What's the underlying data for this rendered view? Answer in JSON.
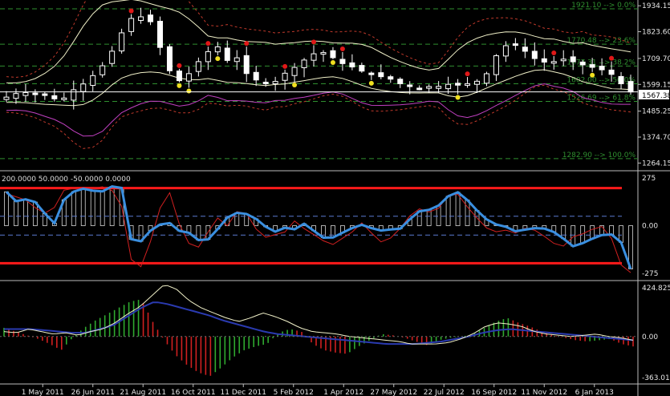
{
  "colors": {
    "background": "#000000",
    "candle_up": "#ffffff",
    "candle_down": "#ffffff",
    "fib_line": "#2f8f2f",
    "price_line": "#ffffff",
    "bb_outer": "#c0392b",
    "envelope_inner": "#f0f0c8",
    "envelope_lower": "#c040c0",
    "cci_main": "#3a8fe0",
    "cci_signal": "#d02020",
    "cci_levels": "#ff1a1a",
    "hist_up": "#2faa2f",
    "hist_down": "#d02020",
    "osc_line": "#f0f0c8",
    "osc_signal": "#2a3ab0"
  },
  "price_axis": {
    "labels": [
      "1934.15",
      "1823.60",
      "1709.70",
      "1599.15",
      "1485.25",
      "1374.70",
      "1264.15"
    ],
    "current": "1567.38"
  },
  "fib_levels": [
    {
      "label": "1921.10 --> 0.0%",
      "value": 1921.1
    },
    {
      "label": "1770.48 --> 23.6%",
      "value": 1770.48
    },
    {
      "label": "1677.31 --> 38.2%",
      "value": 1677.31
    },
    {
      "label": "1602.00 --> 50.0%",
      "value": 1602.0
    },
    {
      "label": "1526.69 --> 61.8%",
      "value": 1526.69
    },
    {
      "label": "1282.90 --> 100.0%",
      "value": 1282.9
    }
  ],
  "cci_panel": {
    "header": "200.0000 50.0000 -50.0000 0.0000",
    "axis": [
      "275",
      "0.00",
      "-275"
    ],
    "levels": [
      200,
      50,
      -50,
      -200
    ]
  },
  "osc_panel": {
    "axis": [
      "424.825",
      "0.00",
      "-363.019"
    ]
  },
  "time_axis": [
    "1 May 2011",
    "26 Jun 2011",
    "21 Aug 2011",
    "16 Oct 2011",
    "11 Dec 2011",
    "5 Feb 2012",
    "1 Apr 2012",
    "27 May 2012",
    "22 Jul 2012",
    "16 Sep 2012",
    "11 Nov 2012",
    "6 Jan 2013"
  ],
  "chart_data": [
    {
      "type": "candlestick",
      "title": "",
      "ylim": [
        1245,
        1945
      ],
      "x": [
        "1 May 2011",
        "26 Jun 2011",
        "21 Aug 2011",
        "16 Oct 2011",
        "11 Dec 2011",
        "5 Feb 2012",
        "1 Apr 2012",
        "27 May 2012",
        "22 Jul 2012",
        "16 Sep 2012",
        "11 Nov 2012",
        "6 Jan 2013"
      ],
      "close_series": [
        1545,
        1560,
        1565,
        1555,
        1560,
        1540,
        1530,
        1570,
        1590,
        1620,
        1660,
        1700,
        1780,
        1850,
        1900,
        1880,
        1860,
        1720,
        1640,
        1610,
        1650,
        1700,
        1740,
        1760,
        1700,
        1720,
        1650,
        1620,
        1610,
        1600,
        1640,
        1660,
        1690,
        1720,
        1740,
        1730,
        1700,
        1680,
        1670,
        1650,
        1640,
        1630,
        1620,
        1600,
        1590,
        1580,
        1590,
        1590,
        1600,
        1595,
        1600,
        1610,
        1620,
        1700,
        1760,
        1770,
        1760,
        1720,
        1700,
        1690,
        1700,
        1710,
        1690,
        1680,
        1670,
        1660,
        1640,
        1600,
        1567
      ],
      "fibonacci": [
        {
          "level": "0.0%",
          "value": 1921.1
        },
        {
          "level": "23.6%",
          "value": 1770.48
        },
        {
          "level": "38.2%",
          "value": 1677.31
        },
        {
          "level": "50.0%",
          "value": 1602.0
        },
        {
          "level": "61.8%",
          "value": 1526.69
        },
        {
          "level": "100.0%",
          "value": 1282.9
        }
      ],
      "current_price": 1567.38
    },
    {
      "type": "line",
      "ylim": [
        -275,
        275
      ],
      "levels": [
        200,
        50,
        -50,
        -200
      ],
      "series": [
        {
          "values": [
            180,
            120,
            150,
            100,
            -10,
            140,
            190,
            200,
            170,
            210,
            200,
            -140,
            -50,
            0,
            20,
            -30,
            -40,
            -100,
            -40,
            40,
            70,
            60,
            20,
            -40,
            -10,
            -20,
            20,
            -60,
            -70,
            -40,
            -10,
            10,
            -30,
            -20,
            -20,
            40,
            90,
            80,
            150,
            180,
            130,
            60,
            10,
            0,
            -30,
            -20,
            -10,
            -20,
            -60,
            -110,
            -90,
            -60,
            -40,
            -60,
            -230
          ]
        },
        {
          "values": [
            170,
            150,
            130,
            60,
            80,
            190,
            200,
            190,
            210,
            200,
            100,
            -250,
            -200,
            50,
            200,
            0,
            -120,
            -110,
            60,
            -10,
            80,
            60,
            -70,
            -50,
            -40,
            30,
            -30,
            -60,
            -110,
            -70,
            -30,
            30,
            -90,
            -80,
            -20,
            60,
            100,
            50,
            160,
            170,
            90,
            20,
            -40,
            -20,
            -40,
            -10,
            -30,
            -80,
            -120,
            -60,
            -40,
            -10,
            0,
            -200,
            -250
          ]
        }
      ]
    },
    {
      "type": "bar",
      "ylim": [
        -363.019,
        424.825
      ],
      "values": [
        70,
        40,
        10,
        -20,
        -60,
        -110,
        -10,
        70,
        130,
        180,
        230,
        280,
        300,
        120,
        -30,
        -150,
        -230,
        -290,
        -320,
        -250,
        -170,
        -110,
        -80,
        -60,
        30,
        60,
        40,
        -60,
        -110,
        -130,
        -140,
        -80,
        -30,
        20,
        10,
        -10,
        -40,
        -70,
        -30,
        -10,
        0,
        20,
        70,
        120,
        150,
        110,
        80,
        40,
        10,
        -10,
        -30,
        -40,
        -30,
        -20,
        -60,
        -80
      ],
      "series": [
        {
          "values": [
            40,
            30,
            60,
            40,
            20,
            30,
            10,
            40,
            60,
            110,
            180,
            240,
            330,
            420,
            380,
            290,
            230,
            190,
            150,
            120,
            150,
            190,
            160,
            120,
            70,
            40,
            30,
            20,
            0,
            -10,
            -20,
            -30,
            -40,
            -60,
            -60,
            -60,
            -50,
            -20,
            20,
            80,
            110,
            100,
            80,
            40,
            20,
            10,
            0,
            10,
            20,
            0,
            -10,
            -30
          ]
        },
        {
          "values": [
            60,
            60,
            60,
            50,
            40,
            30,
            30,
            60,
            90,
            160,
            230,
            280,
            260,
            230,
            200,
            170,
            130,
            100,
            70,
            40,
            20,
            10,
            0,
            -10,
            -20,
            -30,
            -40,
            -50,
            -60,
            -60,
            -60,
            -50,
            -40,
            -20,
            0,
            30,
            50,
            60,
            50,
            40,
            30,
            20,
            10,
            0,
            -10,
            -20,
            -30
          ]
        }
      ]
    }
  ]
}
